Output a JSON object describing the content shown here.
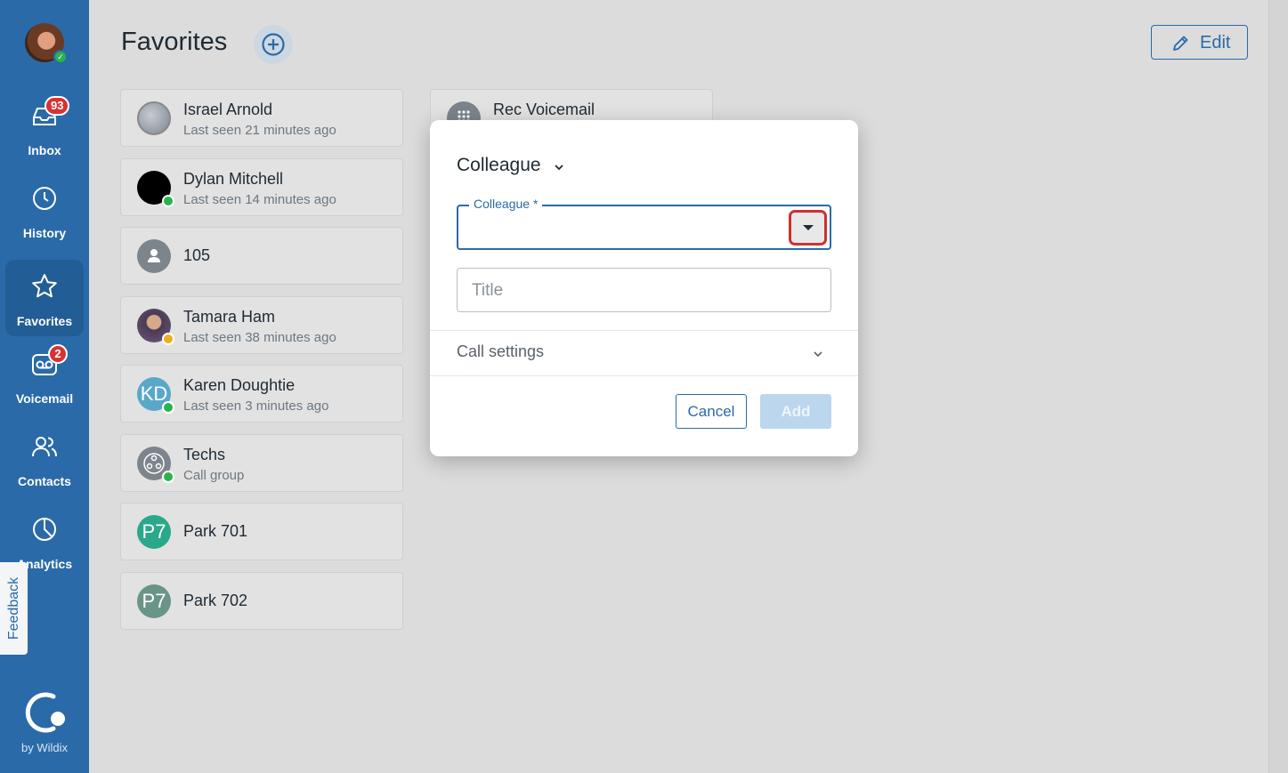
{
  "sidebar": {
    "nav": [
      {
        "label": "Inbox",
        "badge": "93"
      },
      {
        "label": "History"
      },
      {
        "label": "Favorites"
      },
      {
        "label": "Voicemail",
        "badge": "2"
      },
      {
        "label": "Contacts"
      },
      {
        "label": "Analytics"
      }
    ],
    "feedback_label": "Feedback",
    "brand_label": "by Wildix"
  },
  "header": {
    "title": "Favorites",
    "edit_label": "Edit"
  },
  "favorites": [
    {
      "name": "Israel Arnold",
      "sub": "Last seen 21 minutes ago"
    },
    {
      "name": "Dylan Mitchell",
      "sub": "Last seen 14 minutes ago"
    },
    {
      "name": "105"
    },
    {
      "name": "Tamara Ham",
      "sub": "Last seen 38 minutes ago"
    },
    {
      "name": "Karen Doughtie",
      "sub": "Last seen 3 minutes ago",
      "initials": "KD"
    },
    {
      "name": "Techs",
      "sub": "Call group"
    },
    {
      "name": "Park 701",
      "initials": "P7"
    },
    {
      "name": "Park 702",
      "initials": "P7"
    },
    {
      "name": "Rec Voicemail"
    }
  ],
  "dialog": {
    "type_label": "Colleague",
    "colleague_field_label": "Colleague *",
    "colleague_value": "",
    "title_placeholder": "Title",
    "call_settings_label": "Call settings",
    "cancel_label": "Cancel",
    "add_label": "Add"
  },
  "colors": {
    "sidebar": "#2a6aa8",
    "accent": "#2a6aa8",
    "badge": "#d63333",
    "online": "#2ab24f",
    "away": "#e8b020",
    "highlight": "#d03030"
  }
}
